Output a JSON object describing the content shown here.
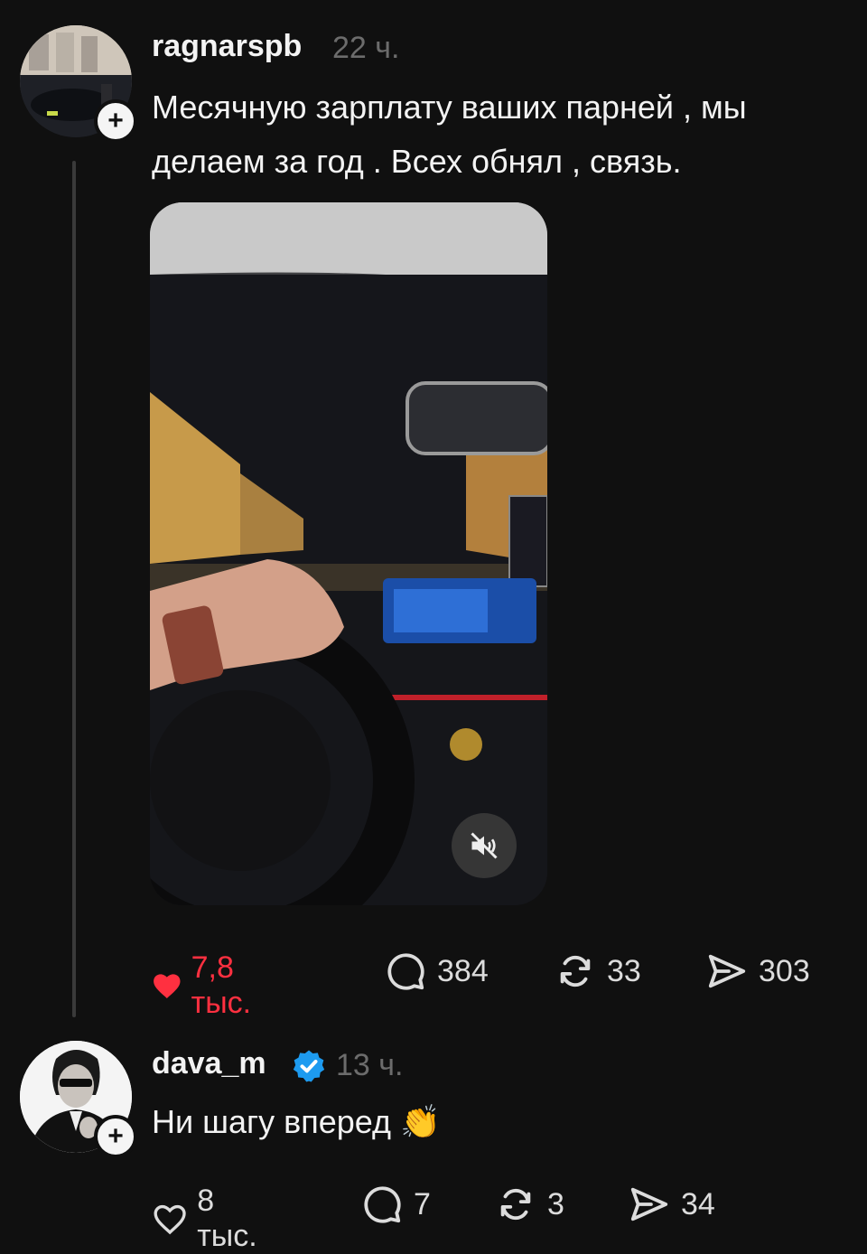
{
  "posts": [
    {
      "username": "ragnarspb",
      "time": "22 ч.",
      "text_line1": "Месячную зарплату ваших парней , мы",
      "text_line2": "делаем за год . Всех обнял , связь.",
      "liked": true,
      "likes": "7,8 тыс.",
      "comments": "384",
      "reposts": "33",
      "shares": "303",
      "media_icon": "mute-icon"
    },
    {
      "username": "dava_m",
      "verified": true,
      "time": "13 ч.",
      "text": "Ни шагу вперед 👏",
      "liked": false,
      "likes": "8 тыс.",
      "comments": "7",
      "reposts": "3",
      "shares": "34"
    }
  ],
  "colors": {
    "like_active": "#ff3040",
    "verified": "#1d9bf0",
    "background": "#101010"
  }
}
